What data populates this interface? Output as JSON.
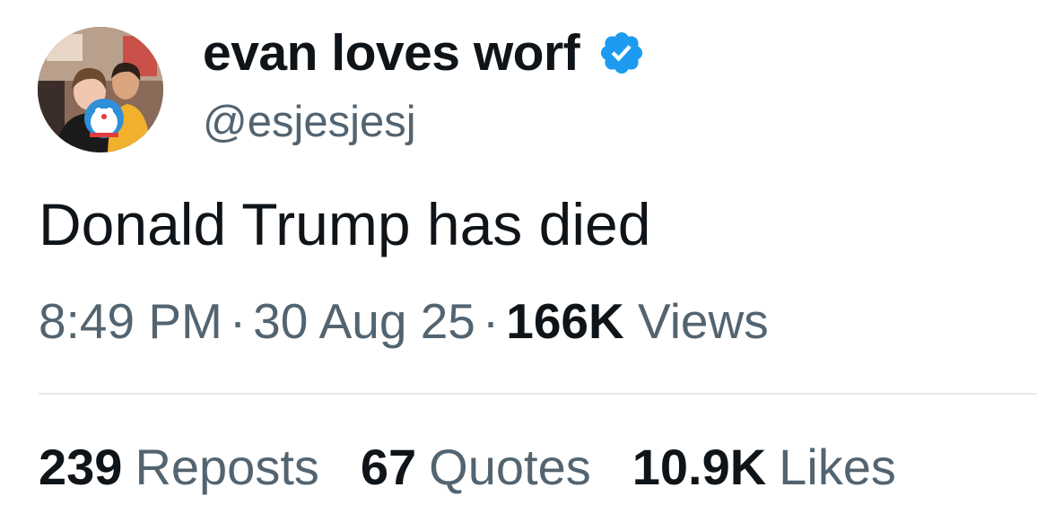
{
  "author": {
    "display_name": "evan loves worf",
    "handle": "@esjesjesj",
    "verified": true,
    "avatar_icon": "profile-photo"
  },
  "tweet": {
    "text": "Donald Trump has died"
  },
  "meta": {
    "time": "8:49 PM",
    "separator": "·",
    "date": "30 Aug 25",
    "views_count": "166K",
    "views_label": "Views"
  },
  "stats": {
    "reposts_count": "239",
    "reposts_label": "Reposts",
    "quotes_count": "67",
    "quotes_label": "Quotes",
    "likes_count": "10.9K",
    "likes_label": "Likes"
  },
  "colors": {
    "text_primary": "#0f1419",
    "text_secondary": "#536471",
    "verified_blue": "#1d9bf0",
    "divider": "#e7eaed"
  }
}
